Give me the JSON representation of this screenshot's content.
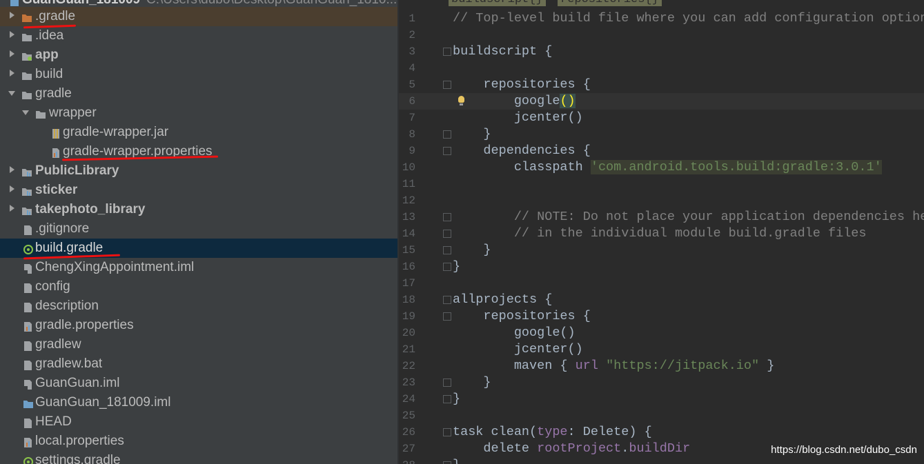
{
  "project_tree": {
    "header": {
      "name": "GuanGuan_181009",
      "path": "C:\\Users\\dubo\\Desktop\\GuanGuan_1810..."
    },
    "items": [
      {
        "label": ".gradle"
      },
      {
        "label": ".idea"
      },
      {
        "label": "app"
      },
      {
        "label": "build"
      },
      {
        "label": "gradle"
      },
      {
        "label": "wrapper"
      },
      {
        "label": "gradle-wrapper.jar"
      },
      {
        "label": "gradle-wrapper.properties"
      },
      {
        "label": "PublicLibrary"
      },
      {
        "label": "sticker"
      },
      {
        "label": "takephoto_library"
      },
      {
        "label": ".gitignore"
      },
      {
        "label": "build.gradle"
      },
      {
        "label": "ChengXingAppointment.iml"
      },
      {
        "label": "config"
      },
      {
        "label": "description"
      },
      {
        "label": "gradle.properties"
      },
      {
        "label": "gradlew"
      },
      {
        "label": "gradlew.bat"
      },
      {
        "label": "GuanGuan.iml"
      },
      {
        "label": "GuanGuan_181009.iml"
      },
      {
        "label": "HEAD"
      },
      {
        "label": "local.properties"
      },
      {
        "label": "settings.gradle"
      }
    ]
  },
  "editor": {
    "breadcrumbs": [
      "buildscript{}",
      "repositories{}"
    ],
    "lines": [
      {
        "n": "1",
        "parts": [
          "// Top-level build file where you can add configuration options common to all sub-projects/modules."
        ]
      },
      {
        "n": "2",
        "parts": [
          ""
        ]
      },
      {
        "n": "3",
        "parts": [
          "buildscript {"
        ]
      },
      {
        "n": "4",
        "parts": [
          ""
        ]
      },
      {
        "n": "5",
        "parts": [
          "    repositories {"
        ]
      },
      {
        "n": "6",
        "parts": [
          "        google",
          "()"
        ]
      },
      {
        "n": "7",
        "parts": [
          "        jcenter()"
        ]
      },
      {
        "n": "8",
        "parts": [
          "    }"
        ]
      },
      {
        "n": "9",
        "parts": [
          "    dependencies {"
        ]
      },
      {
        "n": "10",
        "parts": [
          "        classpath ",
          "'com.android.tools.build:gradle:3.0.1'"
        ]
      },
      {
        "n": "11",
        "parts": [
          ""
        ]
      },
      {
        "n": "12",
        "parts": [
          ""
        ]
      },
      {
        "n": "13",
        "parts": [
          "        // NOTE: Do not place your application dependencies here; they belong"
        ]
      },
      {
        "n": "14",
        "parts": [
          "        // in the individual module build.gradle files"
        ]
      },
      {
        "n": "15",
        "parts": [
          "    }"
        ]
      },
      {
        "n": "16",
        "parts": [
          "}"
        ]
      },
      {
        "n": "17",
        "parts": [
          ""
        ]
      },
      {
        "n": "18",
        "parts": [
          "allprojects {"
        ]
      },
      {
        "n": "19",
        "parts": [
          "    repositories {"
        ]
      },
      {
        "n": "20",
        "parts": [
          "        google()"
        ]
      },
      {
        "n": "21",
        "parts": [
          "        jcenter()"
        ]
      },
      {
        "n": "22",
        "parts": [
          "        maven { ",
          "url",
          " ",
          "\"https://jitpack.io\"",
          " }"
        ]
      },
      {
        "n": "23",
        "parts": [
          "    }"
        ]
      },
      {
        "n": "24",
        "parts": [
          "}"
        ]
      },
      {
        "n": "25",
        "parts": [
          ""
        ]
      },
      {
        "n": "26",
        "parts": [
          "task clean(",
          "type",
          ": Delete) {"
        ]
      },
      {
        "n": "27",
        "parts": [
          "    delete ",
          "rootProject",
          ".",
          "buildDir"
        ]
      },
      {
        "n": "28",
        "parts": [
          "}"
        ]
      }
    ]
  },
  "watermark": "https://blog.csdn.net/dubo_csdn",
  "colors": {
    "tree_bg": "#3c3f41",
    "editor_bg": "#2b2b2b",
    "selection": "#0d293e",
    "annotation": "#ee1111"
  }
}
